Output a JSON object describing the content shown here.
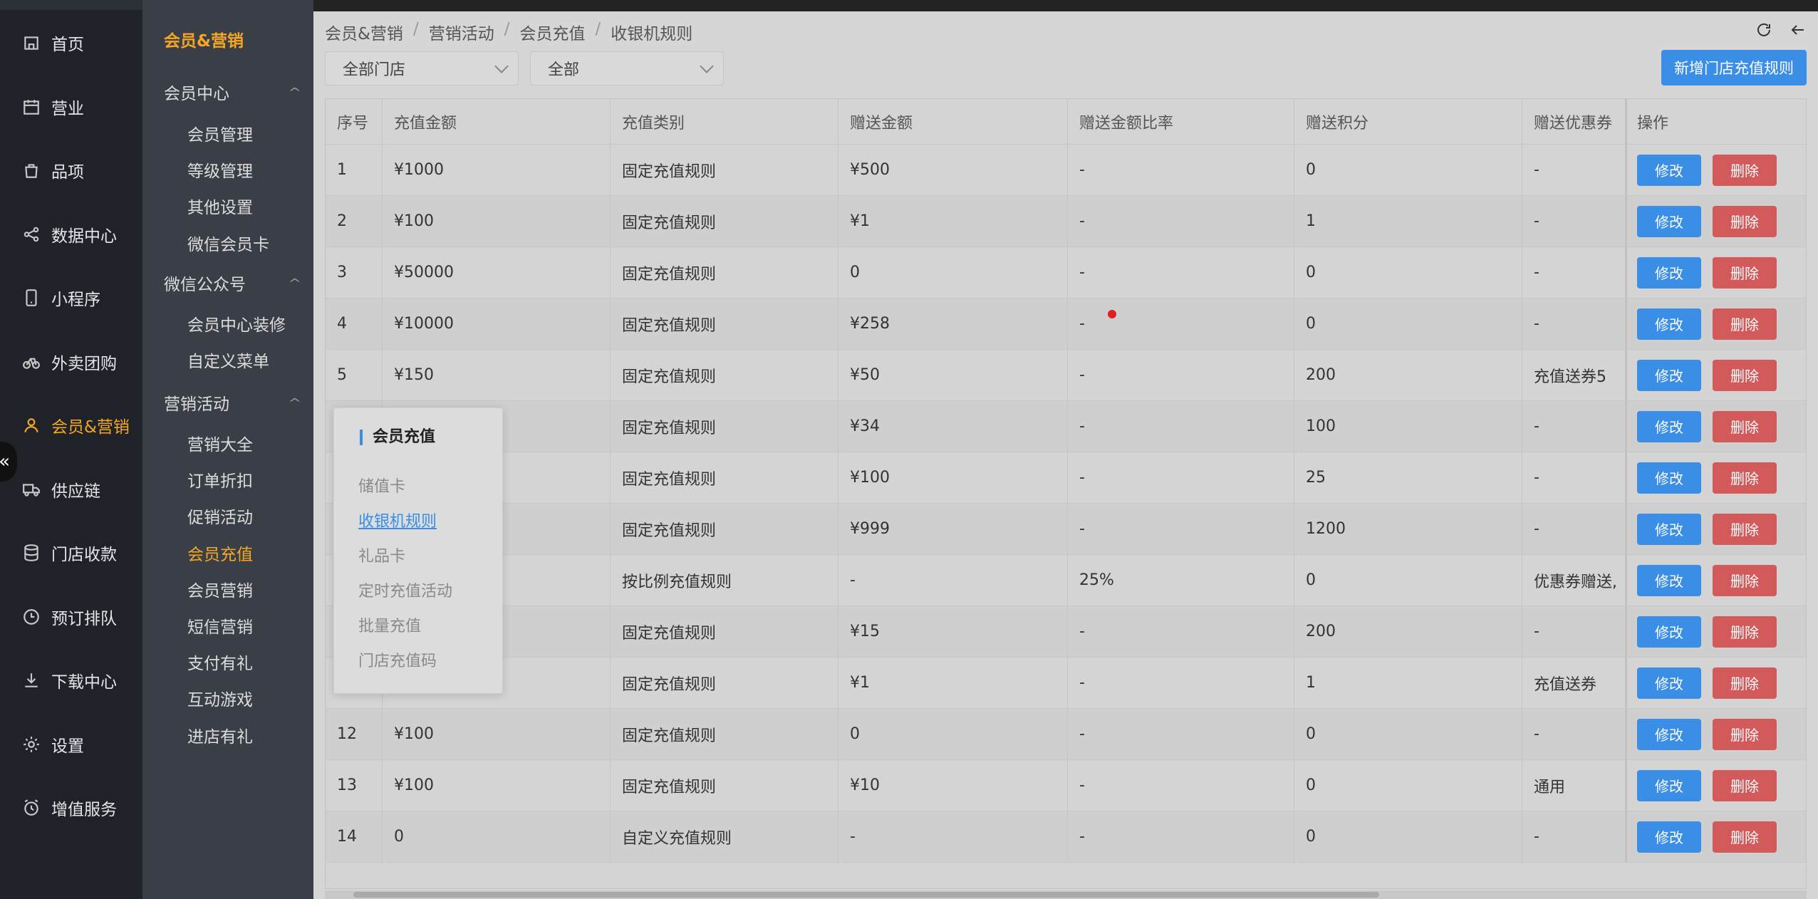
{
  "main_nav": [
    {
      "label": "首页",
      "icon": "home-icon"
    },
    {
      "label": "营业",
      "icon": "calendar-icon"
    },
    {
      "label": "品项",
      "icon": "bag-icon"
    },
    {
      "label": "数据中心",
      "icon": "share-icon"
    },
    {
      "label": "小程序",
      "icon": "phone-icon"
    },
    {
      "label": "外卖团购",
      "icon": "bike-icon"
    },
    {
      "label": "会员&营销",
      "icon": "user-icon",
      "active": true
    },
    {
      "label": "供应链",
      "icon": "truck-icon"
    },
    {
      "label": "门店收款",
      "icon": "database-icon"
    },
    {
      "label": "预订排队",
      "icon": "clock-icon"
    },
    {
      "label": "下载中心",
      "icon": "download-icon"
    },
    {
      "label": "设置",
      "icon": "gear-icon"
    },
    {
      "label": "增值服务",
      "icon": "alarm-icon"
    }
  ],
  "sub_nav": {
    "title": "会员&营销",
    "groups": [
      {
        "label": "会员中心",
        "items": [
          "会员管理",
          "等级管理",
          "其他设置",
          "微信会员卡"
        ]
      },
      {
        "label": "微信公众号",
        "items": [
          "会员中心装修",
          "自定义菜单"
        ]
      },
      {
        "label": "营销活动",
        "items": [
          "营销大全",
          "订单折扣",
          "促销活动",
          "会员充值",
          "会员营销",
          "短信营销",
          "支付有礼",
          "互动游戏",
          "进店有礼"
        ]
      }
    ],
    "active_item": "会员充值"
  },
  "breadcrumb": [
    "会员&营销",
    "营销活动",
    "会员充值",
    "收银机规则"
  ],
  "breadcrumb_sep": "/",
  "filters": {
    "store": "全部门店",
    "type": "全部"
  },
  "add_button": "新增门店充值规则",
  "table": {
    "columns": [
      "序号",
      "充值金额",
      "充值类别",
      "赠送金额",
      "赠送金额比率",
      "赠送积分",
      "赠送优惠券",
      "操作"
    ],
    "rows": [
      [
        "1",
        "¥1000",
        "固定充值规则",
        "¥500",
        "-",
        "0",
        "-"
      ],
      [
        "2",
        "¥100",
        "固定充值规则",
        "¥1",
        "-",
        "1",
        "-"
      ],
      [
        "3",
        "¥50000",
        "固定充值规则",
        "0",
        "-",
        "0",
        "-"
      ],
      [
        "4",
        "¥10000",
        "固定充值规则",
        "¥258",
        "-",
        "0",
        "-"
      ],
      [
        "5",
        "¥150",
        "固定充值规则",
        "¥50",
        "-",
        "200",
        "充值送券5"
      ],
      [
        "",
        "",
        "固定充值规则",
        "¥34",
        "-",
        "100",
        "-"
      ],
      [
        "",
        "",
        "固定充值规则",
        "¥100",
        "-",
        "25",
        "-"
      ],
      [
        "",
        "",
        "固定充值规则",
        "¥999",
        "-",
        "1200",
        "-"
      ],
      [
        "",
        "",
        "按比例充值规则",
        "-",
        "25%",
        "0",
        "优惠券赠送, "
      ],
      [
        "",
        "",
        "固定充值规则",
        "¥15",
        "-",
        "200",
        "-"
      ],
      [
        "",
        "",
        "固定充值规则",
        "¥1",
        "-",
        "1",
        "充值送券"
      ],
      [
        "12",
        "¥100",
        "固定充值规则",
        "0",
        "-",
        "0",
        "-"
      ],
      [
        "13",
        "¥100",
        "固定充值规则",
        "¥10",
        "-",
        "0",
        "通用"
      ],
      [
        "14",
        "0",
        "自定义充值规则",
        "-",
        "-",
        "0",
        "-"
      ]
    ],
    "edit_label": "修改",
    "delete_label": "删除"
  },
  "popover": {
    "title": "会员充值",
    "items": [
      "储值卡",
      "收银机规则",
      "礼品卡",
      "定时充值活动",
      "批量充值",
      "门店充值码"
    ],
    "active": "收银机规则"
  },
  "colors": {
    "accent": "#f5a623",
    "primary": "#3a8ee6",
    "danger": "#d25a5a"
  }
}
